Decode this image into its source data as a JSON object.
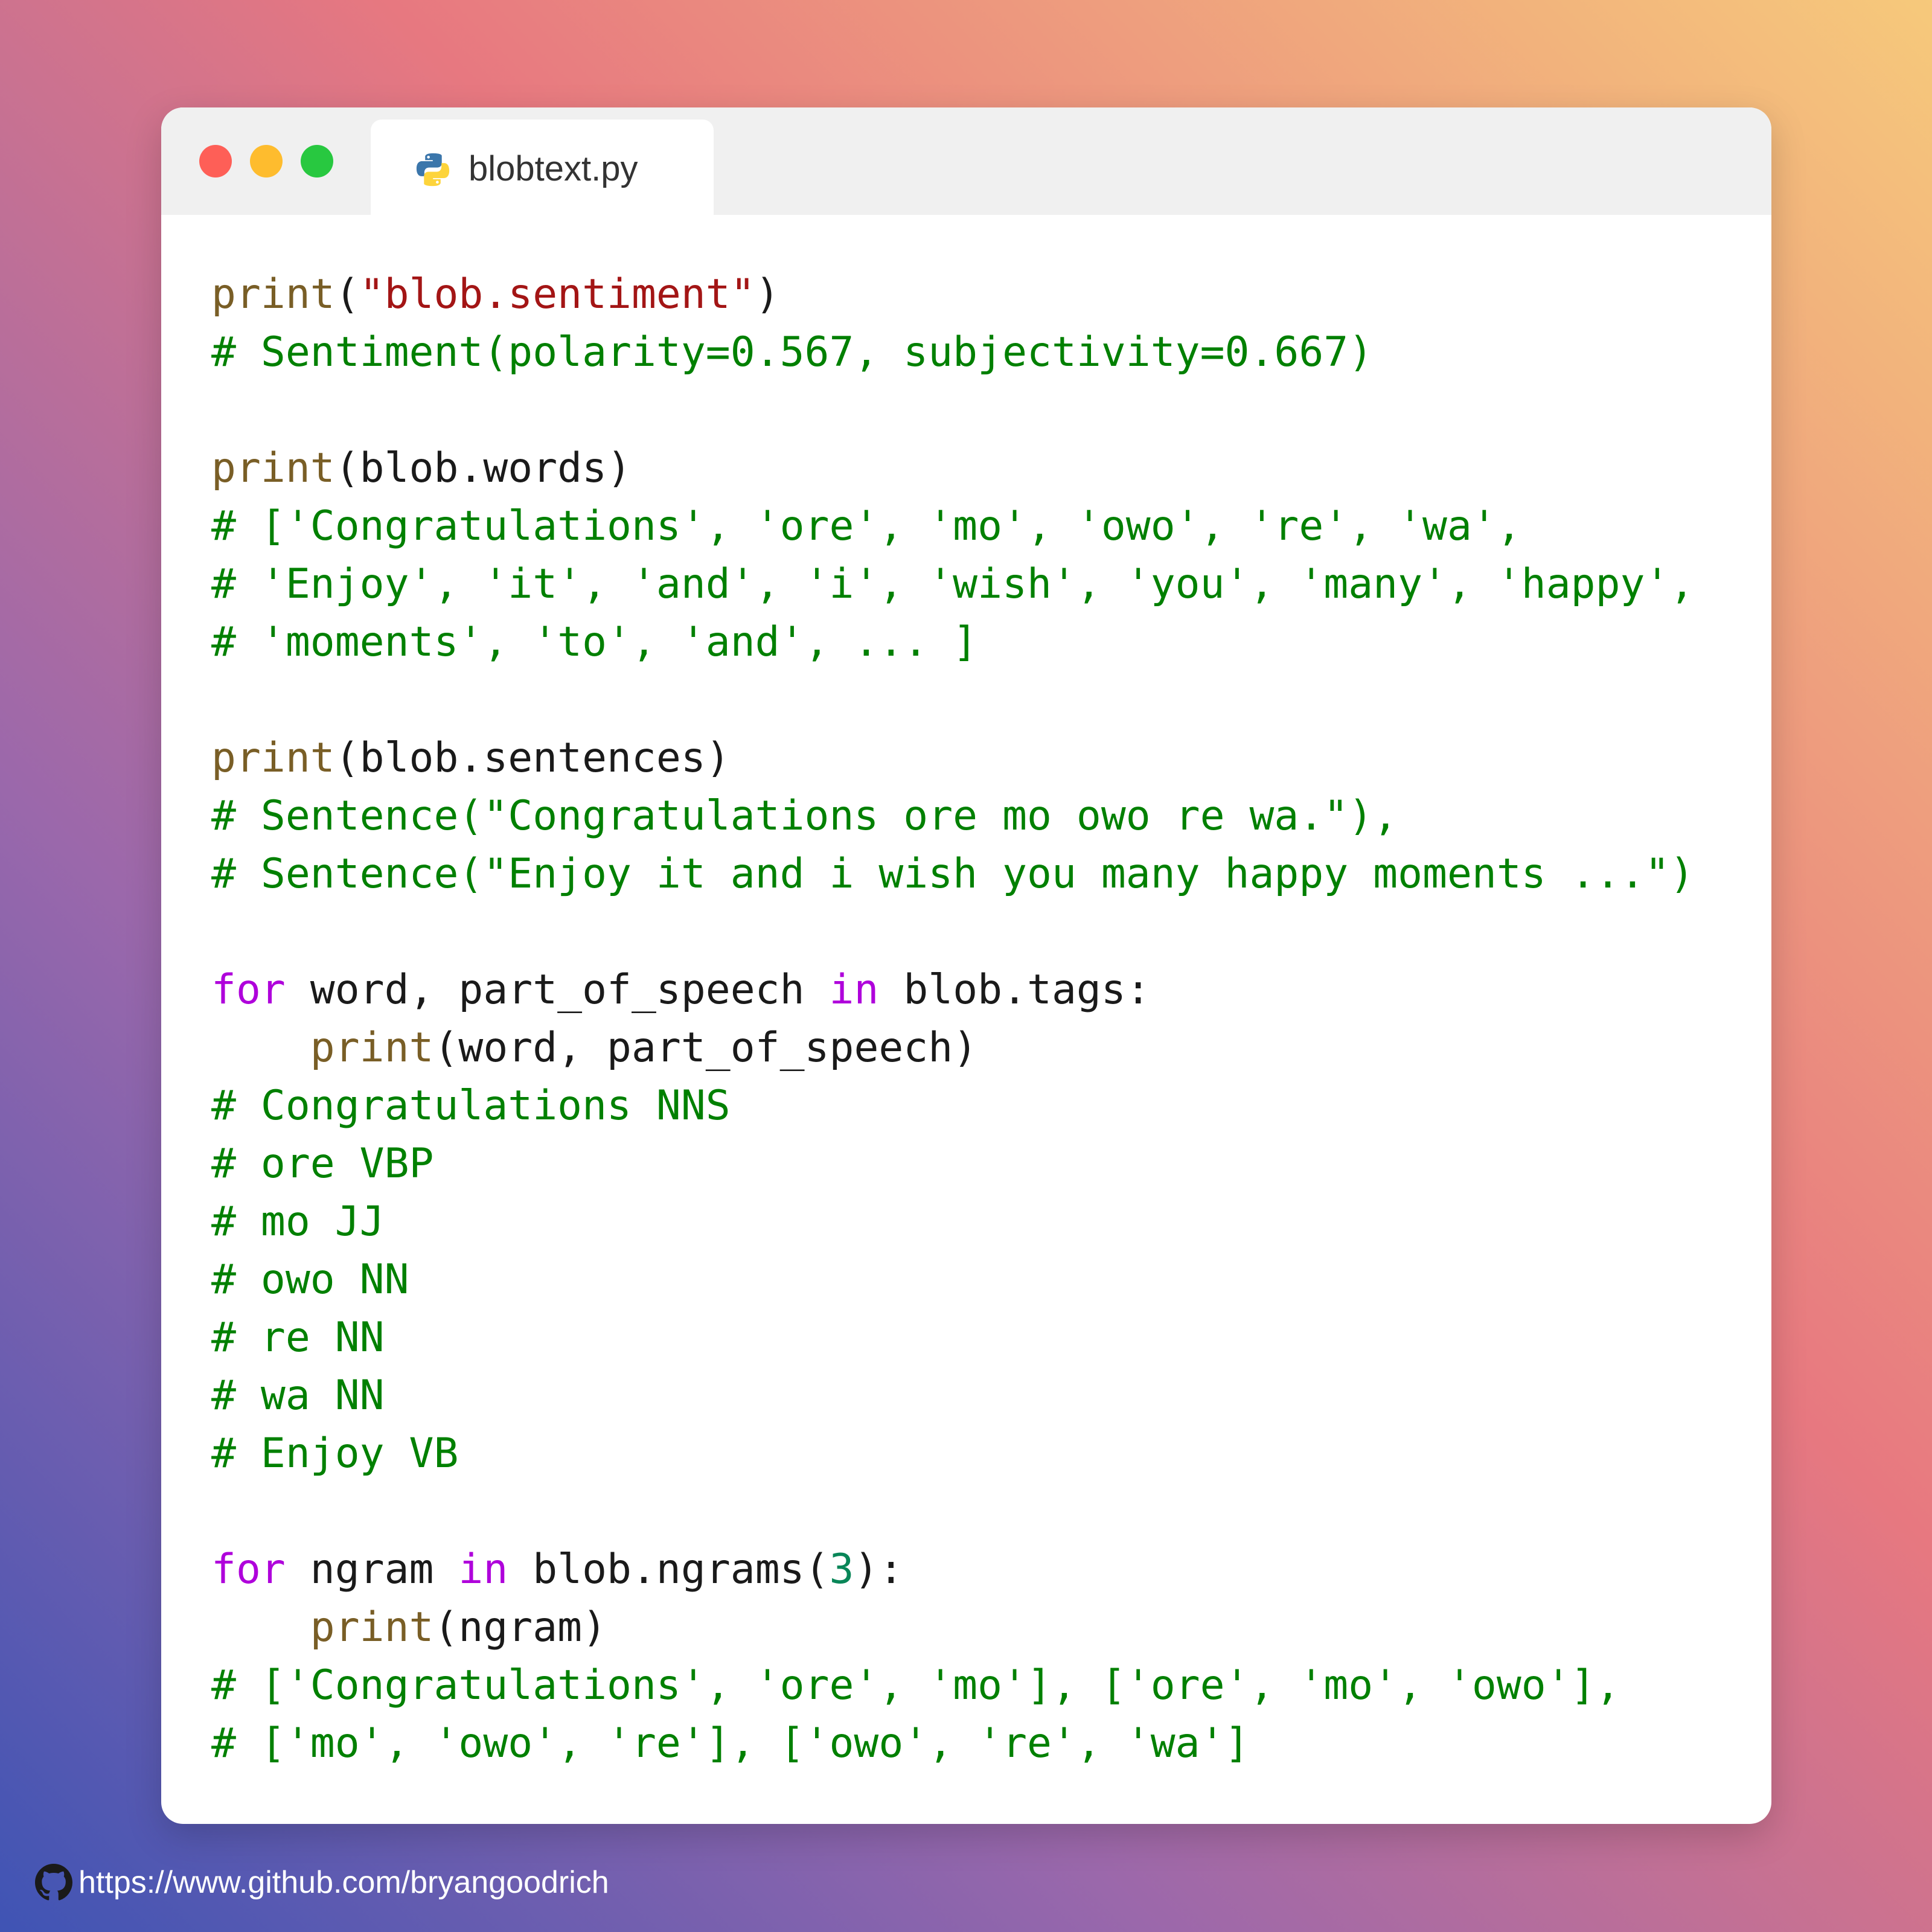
{
  "window": {
    "tab_title": "blobtext.py",
    "tab_icon": "python-icon"
  },
  "code": {
    "l1_fn": "print",
    "l1_p1": "(",
    "l1_str": "\"blob.sentiment\"",
    "l1_p2": ")",
    "l2": "# Sentiment(polarity=0.567, subjectivity=0.667)",
    "l4_fn": "print",
    "l4_rest": "(blob.words)",
    "l5": "# ['Congratulations', 'ore', 'mo', 'owo', 're', 'wa',",
    "l6": "# 'Enjoy', 'it', 'and', 'i', 'wish', 'you', 'many', 'happy',",
    "l7": "# 'moments', 'to', 'and', ... ]",
    "l9_fn": "print",
    "l9_rest": "(blob.sentences)",
    "l10": "# Sentence(\"Congratulations ore mo owo re wa.\"),",
    "l11": "# Sentence(\"Enjoy it and i wish you many happy moments ...\")",
    "l13_kw1": "for",
    "l13_mid": " word, part_of_speech ",
    "l13_kw2": "in",
    "l13_rest": " blob.tags:",
    "l14_indent": "    ",
    "l14_fn": "print",
    "l14_rest": "(word, part_of_speech)",
    "l15": "# Congratulations NNS",
    "l16": "# ore VBP",
    "l17": "# mo JJ",
    "l18": "# owo NN",
    "l19": "# re NN",
    "l20": "# wa NN",
    "l21": "# Enjoy VB",
    "l23_kw1": "for",
    "l23_mid": " ngram ",
    "l23_kw2": "in",
    "l23_rest1": " blob.ngrams(",
    "l23_num": "3",
    "l23_rest2": "):",
    "l24_indent": "    ",
    "l24_fn": "print",
    "l24_rest": "(ngram)",
    "l25": "# ['Congratulations', 'ore', 'mo'], ['ore', 'mo', 'owo'],",
    "l26": "# ['mo', 'owo', 're'], ['owo', 're', 'wa']"
  },
  "footer": {
    "icon": "github-icon",
    "link": "https://www.github.com/bryangoodrich"
  },
  "colors": {
    "function": "#795e26",
    "string": "#a31515",
    "comment": "#008000",
    "keyword": "#af00db",
    "number": "#098658",
    "traffic_red": "#fe5f57",
    "traffic_yellow": "#febc2e",
    "traffic_green": "#28c840"
  }
}
